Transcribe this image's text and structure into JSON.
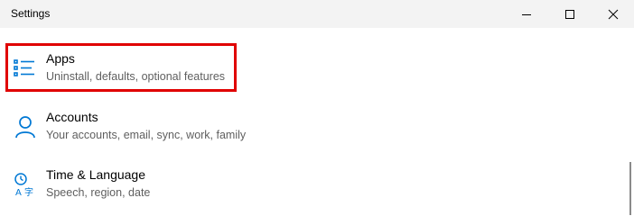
{
  "window": {
    "title": "Settings"
  },
  "titlebar_buttons": {
    "minimize_icon": "minimize-icon",
    "maximize_icon": "maximize-icon",
    "close_icon": "close-icon"
  },
  "settings_items": [
    {
      "label": "Apps",
      "description": "Uninstall, defaults, optional features",
      "icon": "apps-list-icon",
      "highlighted": true
    },
    {
      "label": "Accounts",
      "description": "Your accounts, email, sync, work, family",
      "icon": "person-icon",
      "highlighted": false
    },
    {
      "label": "Time & Language",
      "description": "Speech, region, date",
      "icon": "time-language-icon",
      "highlighted": false
    }
  ],
  "colors": {
    "accent": "#0078d4",
    "highlight_border": "#e00000",
    "titlebar_bg": "#f3f3f3",
    "description_text": "#5f5f5f"
  }
}
